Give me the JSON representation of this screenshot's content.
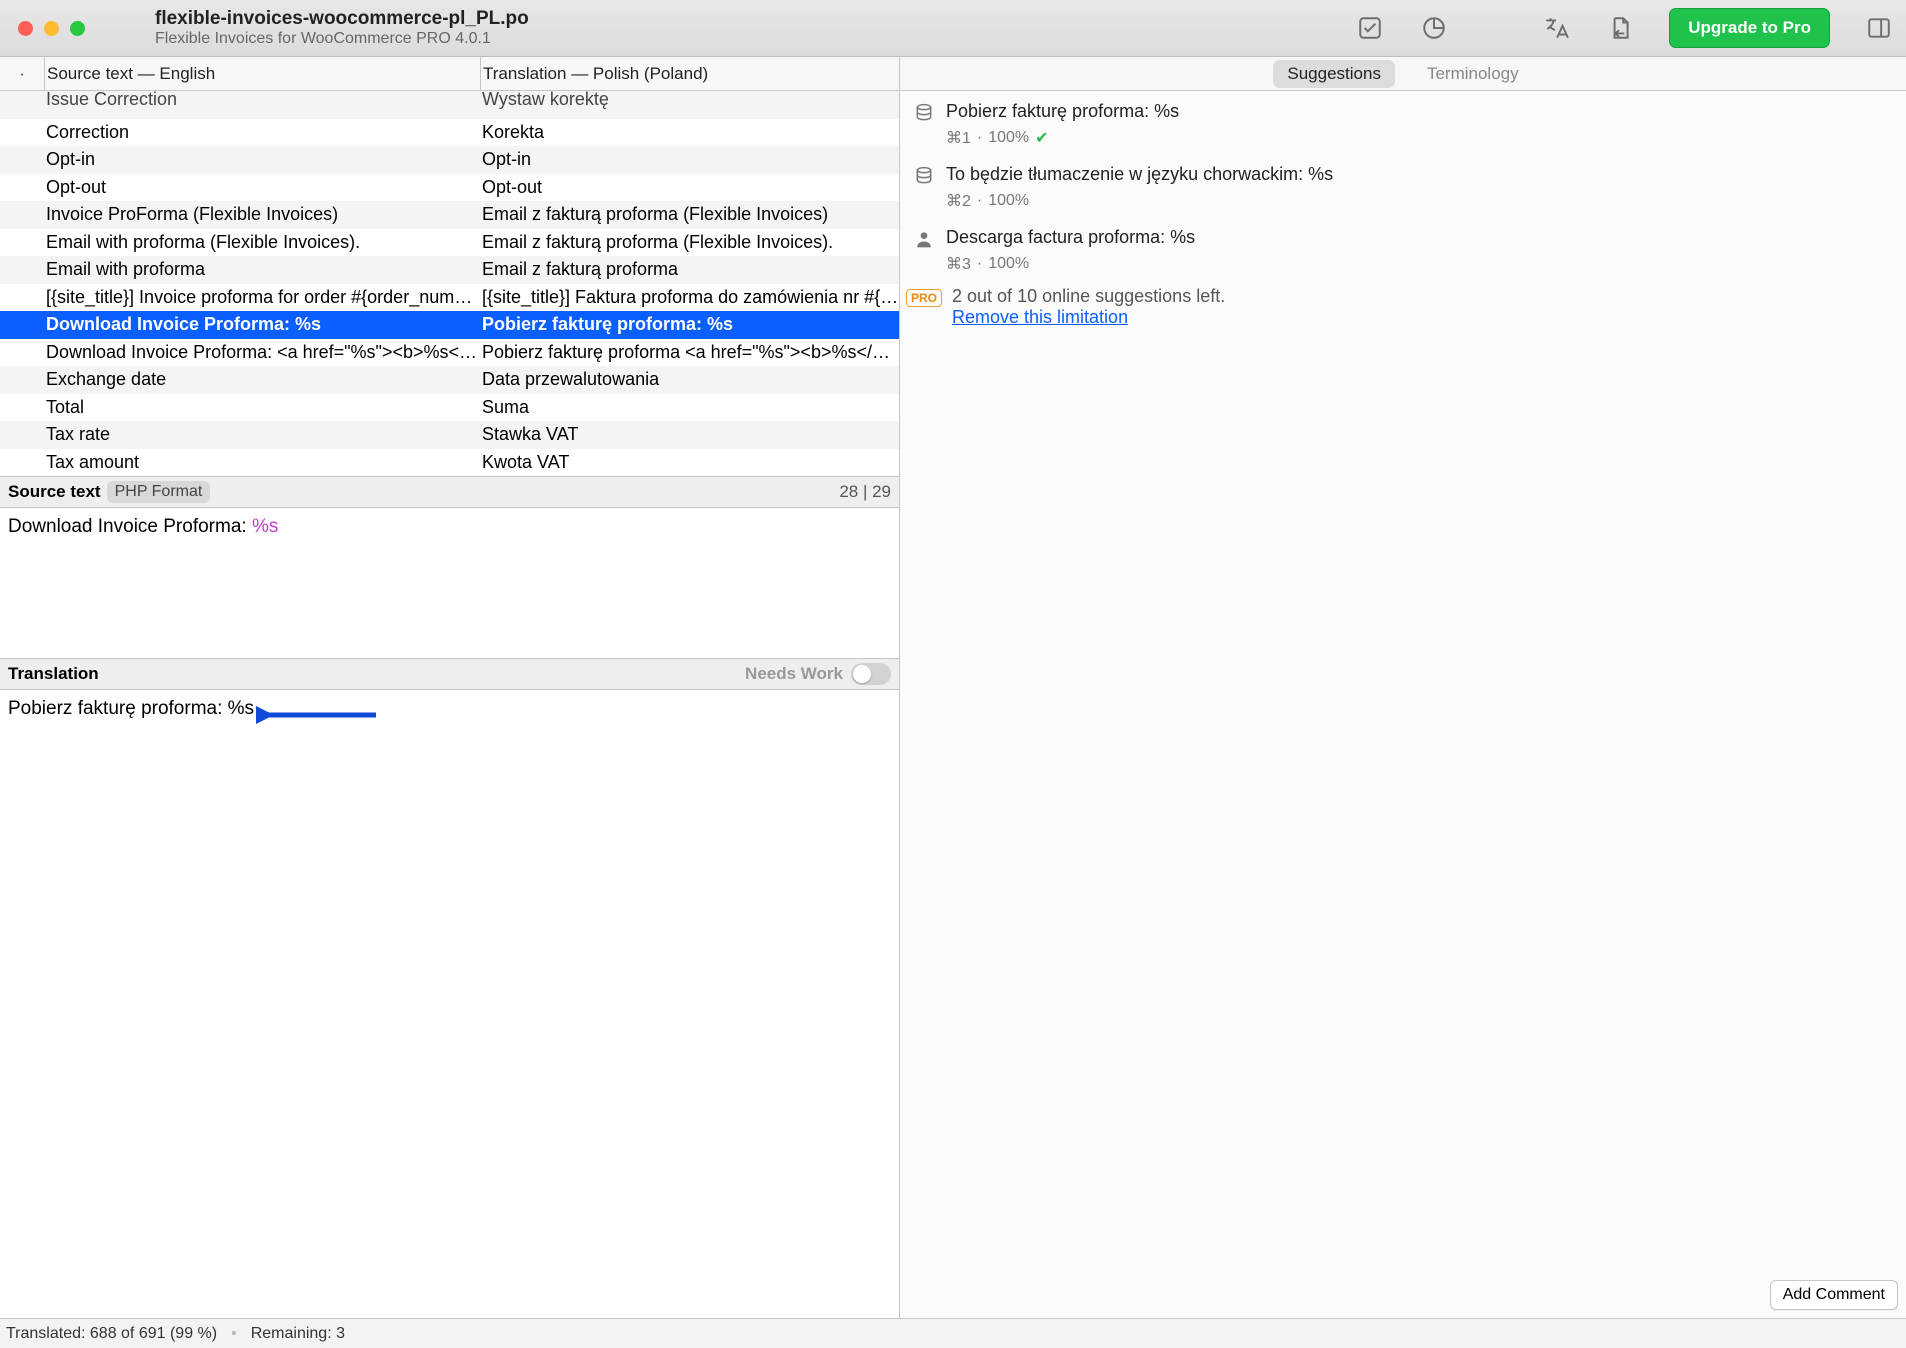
{
  "window": {
    "title": "flexible-invoices-woocommerce-pl_PL.po",
    "subtitle": "Flexible Invoices for WooCommerce PRO 4.0.1"
  },
  "toolbar": {
    "upgrade_label": "Upgrade to Pro"
  },
  "columns": {
    "source_label": "Source text — English",
    "translation_label": "Translation — Polish (Poland)"
  },
  "rows": [
    {
      "source": "Issue Correction",
      "translation": "Wystaw korektę",
      "first": true
    },
    {
      "source": "Correction",
      "translation": "Korekta"
    },
    {
      "source": "Opt-in",
      "translation": "Opt-in"
    },
    {
      "source": "Opt-out",
      "translation": "Opt-out"
    },
    {
      "source": "Invoice ProForma (Flexible Invoices)",
      "translation": "Email z fakturą proforma (Flexible Invoices)"
    },
    {
      "source": "Email with proforma (Flexible Invoices).",
      "translation": "Email z fakturą proforma (Flexible Invoices)."
    },
    {
      "source": "Email with proforma",
      "translation": "Email z fakturą proforma"
    },
    {
      "source": "[{site_title}] Invoice proforma for order #{order_num…",
      "translation": "[{site_title}] Faktura proforma do zamówienia nr #{or…"
    },
    {
      "source": "Download Invoice Proforma: %s",
      "translation": "Pobierz fakturę proforma: %s",
      "selected": true
    },
    {
      "source": "Download Invoice Proforma: <a href=\"%s\"><b>%s</…",
      "translation": "Pobierz fakturę proforma <a href=\"%s\"><b>%s</b><…"
    },
    {
      "source": "Exchange date",
      "translation": "Data przewalutowania"
    },
    {
      "source": "Total",
      "translation": "Suma"
    },
    {
      "source": "Tax rate",
      "translation": "Stawka VAT"
    },
    {
      "source": "Tax amount",
      "translation": "Kwota VAT"
    }
  ],
  "source_pane": {
    "label": "Source text",
    "badge": "PHP Format",
    "counter": "28 | 29",
    "text_plain": "Download Invoice Proforma: ",
    "text_placeholder": "%s"
  },
  "translation_pane": {
    "label": "Translation",
    "needs_work_label": "Needs Work",
    "text_plain": "Pobierz fakturę proforma: ",
    "text_placeholder": "%s"
  },
  "right": {
    "tab_suggestions": "Suggestions",
    "tab_terminology": "Terminology",
    "suggestions": [
      {
        "icon": "db",
        "title": "Pobierz fakturę proforma: %s",
        "shortcut": "⌘1",
        "score": "100%",
        "check": true
      },
      {
        "icon": "db",
        "title": "To będzie tłumaczenie w języku chorwackim: %s",
        "shortcut": "⌘2",
        "score": "100%",
        "check": false
      },
      {
        "icon": "person",
        "title": "Descarga factura proforma: %s",
        "shortcut": "⌘3",
        "score": "100%",
        "check": false
      }
    ],
    "pro_badge": "PRO",
    "limit_text": "2 out of 10 online suggestions left.",
    "limit_link": "Remove this limitation",
    "add_comment_label": "Add Comment"
  },
  "status": {
    "translated": "Translated: 688 of 691 (99 %)",
    "remaining": "Remaining: 3"
  }
}
